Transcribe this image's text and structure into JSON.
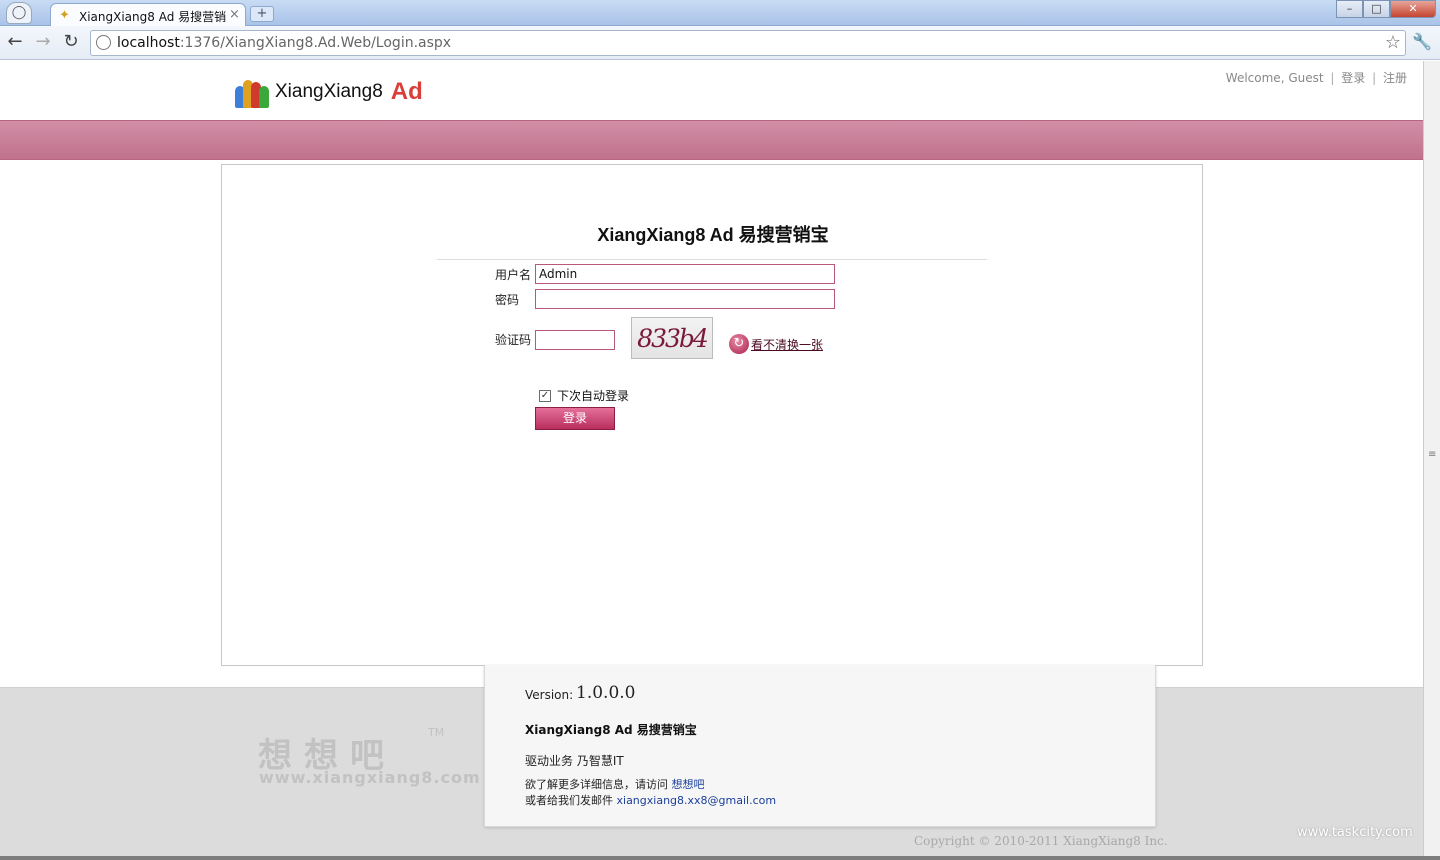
{
  "browser": {
    "tab_title": "XiangXiang8 Ad 易搜营销宝",
    "tab_close": "×",
    "new_tab": "+",
    "url_host": "localhost",
    "url_path": ":1376/XiangXiang8.Ad.Web/Login.aspx",
    "back": "←",
    "forward": "→",
    "reload": "↻",
    "star": "☆",
    "wrench": "🔧",
    "win_min": "–",
    "win_max": "□",
    "win_close": "✕"
  },
  "header": {
    "logo_text": "XiangXiang8",
    "logo_ad": "Ad",
    "welcome": "Welcome, Guest",
    "sep": "|",
    "login_link": "登录",
    "register_link": "注册"
  },
  "login": {
    "title": "XiangXiang8 Ad 易搜营销宝",
    "username_label": "用户名",
    "username_value": "Admin",
    "password_label": "密码",
    "captcha_label": "验证码",
    "captcha_image_text": "833b4",
    "refresh_text": "看不清换一张",
    "remember_label": "下次自动登录",
    "remember_checked": true,
    "submit_label": "登录"
  },
  "footer": {
    "watermark_cn": "想想吧",
    "watermark_tm": "TM",
    "watermark_url": "www.xiangxiang8.com",
    "version_label": "Version:",
    "version_number": "1.0.0.0",
    "product": "XiangXiang8 Ad 易搜营销宝",
    "tagline": "驱动业务 乃智慧IT",
    "contact_prefix": "欲了解更多详细信息，请访问 ",
    "contact_link": "想想吧",
    "email_prefix": "或者给我们发邮件 ",
    "email": "xiangxiang8.xx8@gmail.com",
    "copyright": "Copyright © 2010-2011 XiangXiang8 Inc.",
    "corner_watermark": "www.taskcity.com"
  },
  "colors": {
    "band": "#c77a94",
    "button": "#c8386a",
    "input_border": "#b8577a",
    "logo_ad": "#d9403a"
  }
}
